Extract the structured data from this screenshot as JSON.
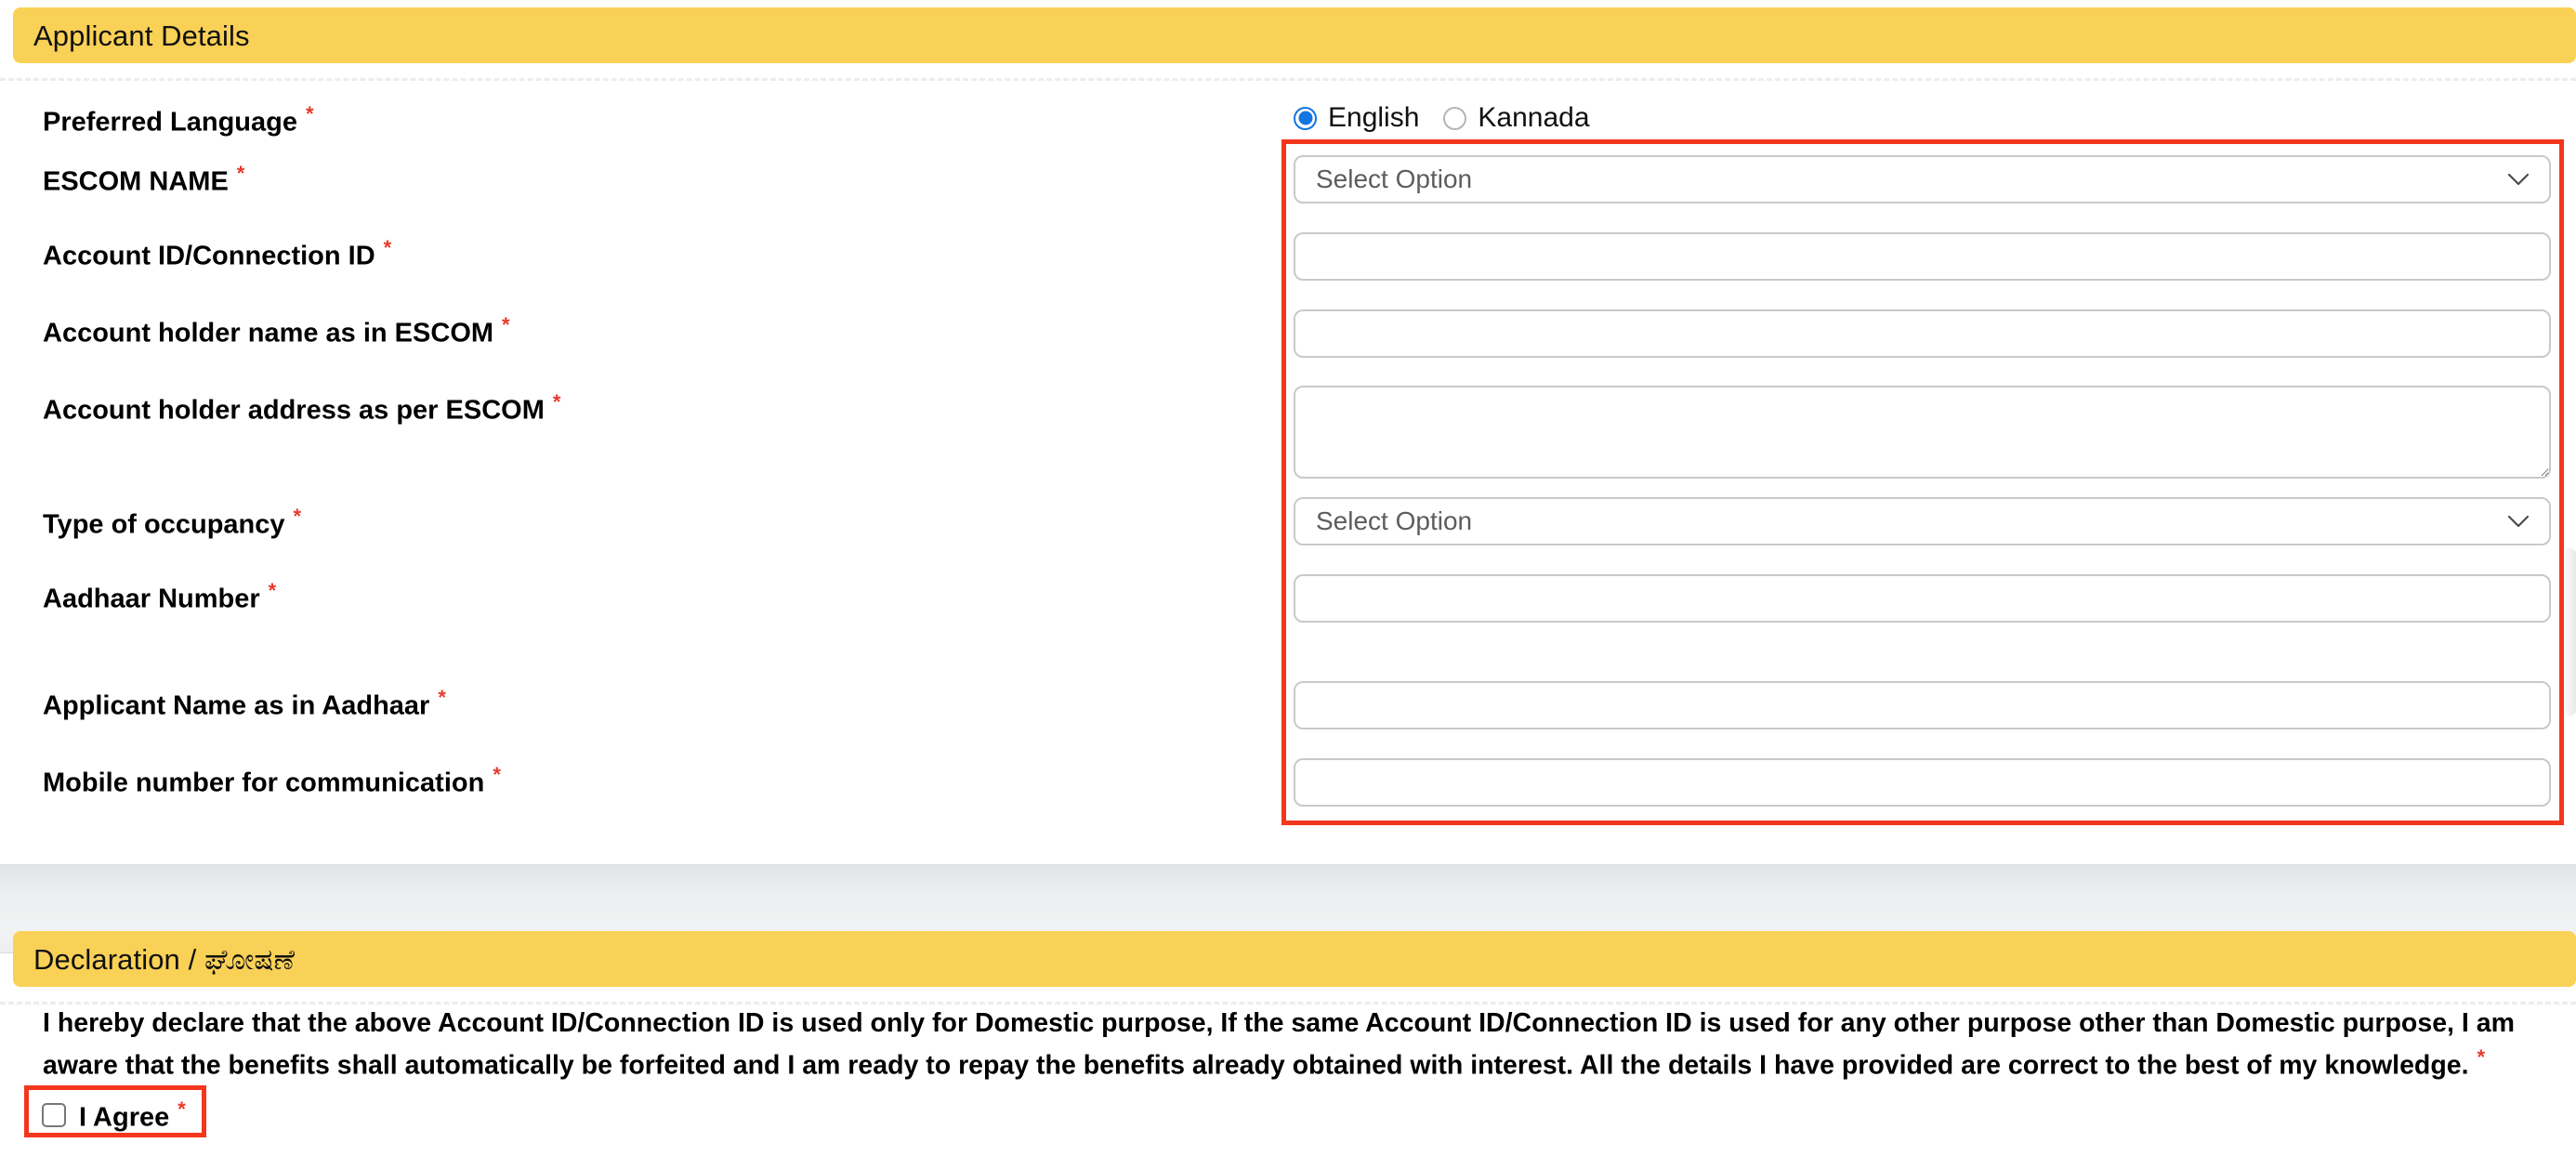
{
  "colors": {
    "banner_yellow": "#F9D156",
    "highlight_red": "#f4361c",
    "required_star_red": "#e8392b",
    "radio_blue": "#1275e0",
    "input_border": "#c9c9c9"
  },
  "applicant_section": {
    "banner_title": "Applicant Details",
    "language_field": {
      "label": "Preferred Language",
      "required_marker": "*",
      "options": [
        {
          "label": "English",
          "selected": true
        },
        {
          "label": "Kannada",
          "selected": false
        }
      ]
    },
    "fields": [
      {
        "label": "ESCOM NAME",
        "required_marker": "*",
        "control": "select",
        "placeholder": "Select Option",
        "value": ""
      },
      {
        "label": "Account ID/Connection ID",
        "required_marker": "*",
        "control": "text",
        "placeholder": "",
        "value": ""
      },
      {
        "label": "Account holder name as in ESCOM",
        "required_marker": "*",
        "control": "text",
        "placeholder": "",
        "value": ""
      },
      {
        "label": "Account holder address as per ESCOM",
        "required_marker": "*",
        "control": "textarea",
        "placeholder": "",
        "value": ""
      },
      {
        "label": "Type of occupancy",
        "required_marker": "*",
        "control": "select",
        "placeholder": "Select Option",
        "value": ""
      },
      {
        "label": "Aadhaar Number",
        "required_marker": "*",
        "control": "text",
        "placeholder": "",
        "value": ""
      },
      {
        "label": "Applicant Name as in Aadhaar",
        "required_marker": "*",
        "control": "text",
        "placeholder": "",
        "value": ""
      },
      {
        "label": "Mobile number for communication",
        "required_marker": "*",
        "control": "text",
        "placeholder": "",
        "value": ""
      }
    ]
  },
  "declaration_section": {
    "banner_title": "Declaration / ಘೋಷಣೆ",
    "text_line_1": "I hereby declare that the above Account ID/Connection ID is used only for Domestic purpose, If the same Account ID/Connection ID is used for any other purpose other than Domestic purpose, I am",
    "text_line_2": "aware that the benefits shall automatically be forfeited and I am ready to repay the benefits already obtained with interest. All the details I have provided are correct to the best of my knowledge.",
    "required_marker": "*",
    "agree": {
      "label": "I Agree",
      "required_marker": "*",
      "checked": false
    }
  }
}
